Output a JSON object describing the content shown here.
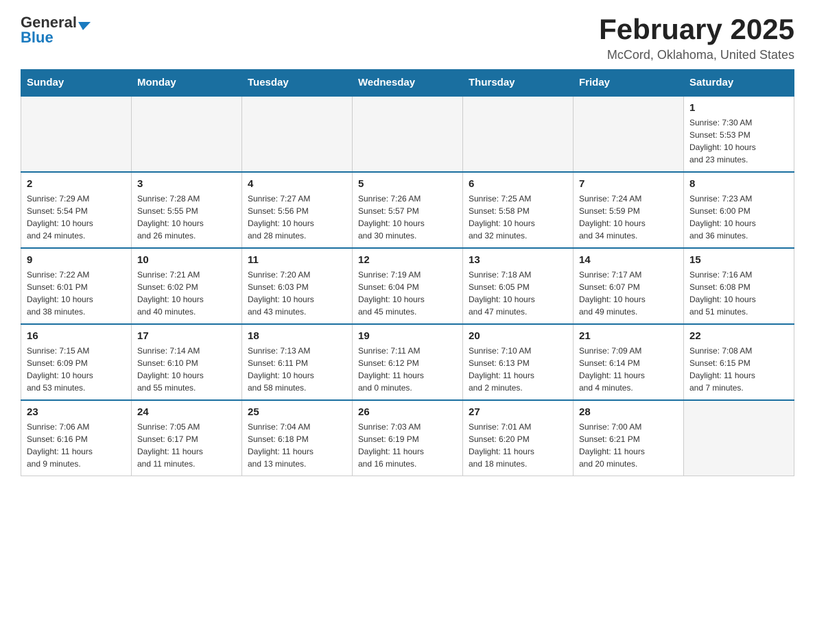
{
  "header": {
    "logo": {
      "general": "General",
      "blue": "Blue"
    },
    "title": "February 2025",
    "location": "McCord, Oklahoma, United States"
  },
  "calendar": {
    "days_of_week": [
      "Sunday",
      "Monday",
      "Tuesday",
      "Wednesday",
      "Thursday",
      "Friday",
      "Saturday"
    ],
    "weeks": [
      [
        {
          "day": "",
          "info": "",
          "empty": true
        },
        {
          "day": "",
          "info": "",
          "empty": true
        },
        {
          "day": "",
          "info": "",
          "empty": true
        },
        {
          "day": "",
          "info": "",
          "empty": true
        },
        {
          "day": "",
          "info": "",
          "empty": true
        },
        {
          "day": "",
          "info": "",
          "empty": true
        },
        {
          "day": "1",
          "info": "Sunrise: 7:30 AM\nSunset: 5:53 PM\nDaylight: 10 hours\nand 23 minutes.",
          "empty": false
        }
      ],
      [
        {
          "day": "2",
          "info": "Sunrise: 7:29 AM\nSunset: 5:54 PM\nDaylight: 10 hours\nand 24 minutes.",
          "empty": false
        },
        {
          "day": "3",
          "info": "Sunrise: 7:28 AM\nSunset: 5:55 PM\nDaylight: 10 hours\nand 26 minutes.",
          "empty": false
        },
        {
          "day": "4",
          "info": "Sunrise: 7:27 AM\nSunset: 5:56 PM\nDaylight: 10 hours\nand 28 minutes.",
          "empty": false
        },
        {
          "day": "5",
          "info": "Sunrise: 7:26 AM\nSunset: 5:57 PM\nDaylight: 10 hours\nand 30 minutes.",
          "empty": false
        },
        {
          "day": "6",
          "info": "Sunrise: 7:25 AM\nSunset: 5:58 PM\nDaylight: 10 hours\nand 32 minutes.",
          "empty": false
        },
        {
          "day": "7",
          "info": "Sunrise: 7:24 AM\nSunset: 5:59 PM\nDaylight: 10 hours\nand 34 minutes.",
          "empty": false
        },
        {
          "day": "8",
          "info": "Sunrise: 7:23 AM\nSunset: 6:00 PM\nDaylight: 10 hours\nand 36 minutes.",
          "empty": false
        }
      ],
      [
        {
          "day": "9",
          "info": "Sunrise: 7:22 AM\nSunset: 6:01 PM\nDaylight: 10 hours\nand 38 minutes.",
          "empty": false
        },
        {
          "day": "10",
          "info": "Sunrise: 7:21 AM\nSunset: 6:02 PM\nDaylight: 10 hours\nand 40 minutes.",
          "empty": false
        },
        {
          "day": "11",
          "info": "Sunrise: 7:20 AM\nSunset: 6:03 PM\nDaylight: 10 hours\nand 43 minutes.",
          "empty": false
        },
        {
          "day": "12",
          "info": "Sunrise: 7:19 AM\nSunset: 6:04 PM\nDaylight: 10 hours\nand 45 minutes.",
          "empty": false
        },
        {
          "day": "13",
          "info": "Sunrise: 7:18 AM\nSunset: 6:05 PM\nDaylight: 10 hours\nand 47 minutes.",
          "empty": false
        },
        {
          "day": "14",
          "info": "Sunrise: 7:17 AM\nSunset: 6:07 PM\nDaylight: 10 hours\nand 49 minutes.",
          "empty": false
        },
        {
          "day": "15",
          "info": "Sunrise: 7:16 AM\nSunset: 6:08 PM\nDaylight: 10 hours\nand 51 minutes.",
          "empty": false
        }
      ],
      [
        {
          "day": "16",
          "info": "Sunrise: 7:15 AM\nSunset: 6:09 PM\nDaylight: 10 hours\nand 53 minutes.",
          "empty": false
        },
        {
          "day": "17",
          "info": "Sunrise: 7:14 AM\nSunset: 6:10 PM\nDaylight: 10 hours\nand 55 minutes.",
          "empty": false
        },
        {
          "day": "18",
          "info": "Sunrise: 7:13 AM\nSunset: 6:11 PM\nDaylight: 10 hours\nand 58 minutes.",
          "empty": false
        },
        {
          "day": "19",
          "info": "Sunrise: 7:11 AM\nSunset: 6:12 PM\nDaylight: 11 hours\nand 0 minutes.",
          "empty": false
        },
        {
          "day": "20",
          "info": "Sunrise: 7:10 AM\nSunset: 6:13 PM\nDaylight: 11 hours\nand 2 minutes.",
          "empty": false
        },
        {
          "day": "21",
          "info": "Sunrise: 7:09 AM\nSunset: 6:14 PM\nDaylight: 11 hours\nand 4 minutes.",
          "empty": false
        },
        {
          "day": "22",
          "info": "Sunrise: 7:08 AM\nSunset: 6:15 PM\nDaylight: 11 hours\nand 7 minutes.",
          "empty": false
        }
      ],
      [
        {
          "day": "23",
          "info": "Sunrise: 7:06 AM\nSunset: 6:16 PM\nDaylight: 11 hours\nand 9 minutes.",
          "empty": false
        },
        {
          "day": "24",
          "info": "Sunrise: 7:05 AM\nSunset: 6:17 PM\nDaylight: 11 hours\nand 11 minutes.",
          "empty": false
        },
        {
          "day": "25",
          "info": "Sunrise: 7:04 AM\nSunset: 6:18 PM\nDaylight: 11 hours\nand 13 minutes.",
          "empty": false
        },
        {
          "day": "26",
          "info": "Sunrise: 7:03 AM\nSunset: 6:19 PM\nDaylight: 11 hours\nand 16 minutes.",
          "empty": false
        },
        {
          "day": "27",
          "info": "Sunrise: 7:01 AM\nSunset: 6:20 PM\nDaylight: 11 hours\nand 18 minutes.",
          "empty": false
        },
        {
          "day": "28",
          "info": "Sunrise: 7:00 AM\nSunset: 6:21 PM\nDaylight: 11 hours\nand 20 minutes.",
          "empty": false
        },
        {
          "day": "",
          "info": "",
          "empty": true
        }
      ]
    ]
  }
}
